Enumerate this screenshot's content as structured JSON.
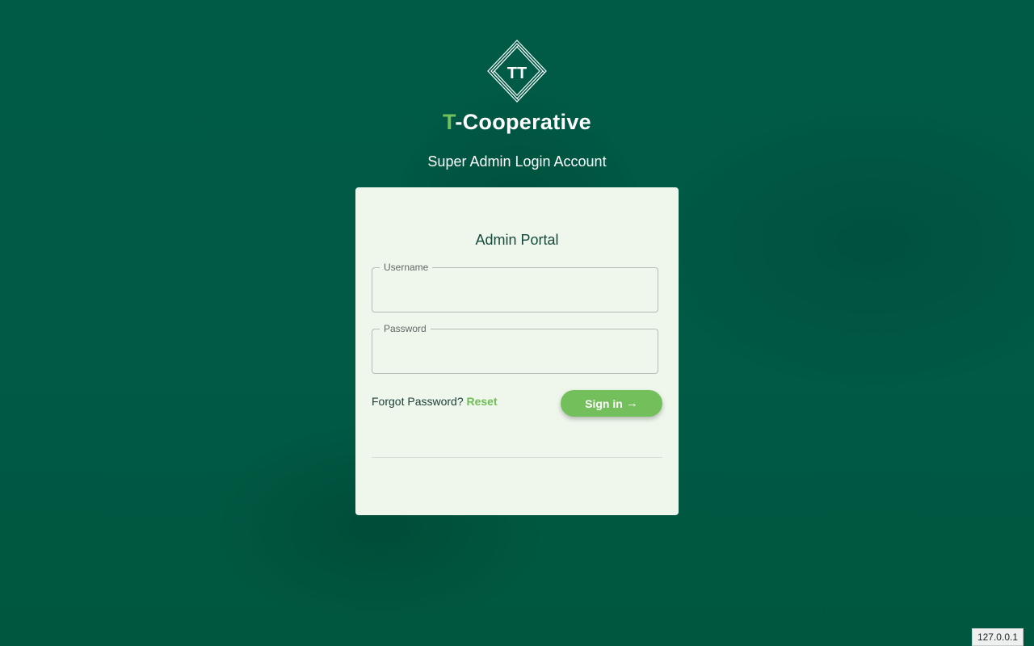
{
  "brand": {
    "logo_icon": "diamond-tt-logo-icon",
    "logo_text": "TT",
    "name_accent": "T",
    "name_rest": "-Cooperative"
  },
  "subtitle": "Super Admin Login Account",
  "card": {
    "title": "Admin Portal",
    "username": {
      "label": "Username",
      "value": "",
      "placeholder": ""
    },
    "password": {
      "label": "Password",
      "value": "",
      "placeholder": ""
    },
    "forgot_text": "Forgot Password?",
    "reset_link": "Reset",
    "signin_label": "Sign in",
    "signin_arrow": "→"
  },
  "status": {
    "host": "127.0.0.1"
  },
  "colors": {
    "background": "#005e48",
    "accent": "#74c05c",
    "card": "#eff7ed",
    "title": "#164a3c"
  }
}
